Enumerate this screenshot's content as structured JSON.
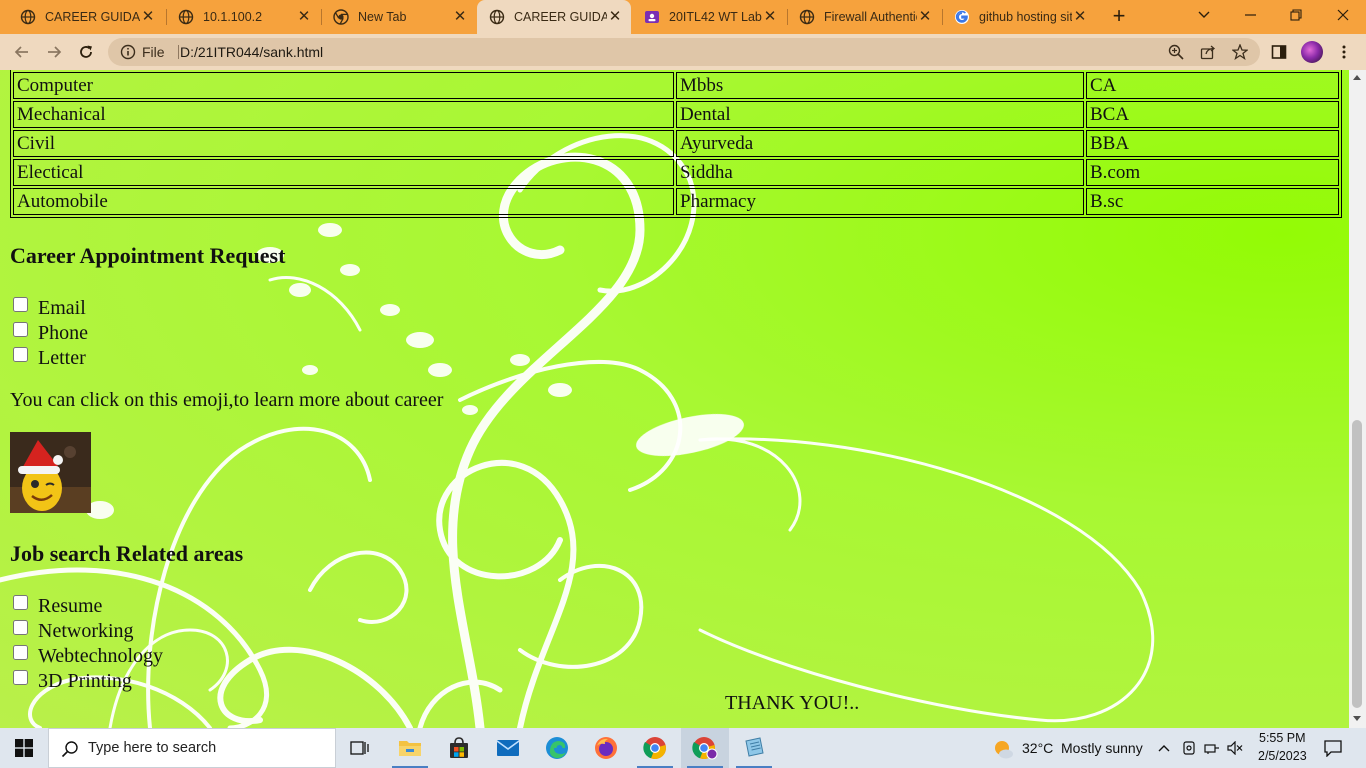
{
  "browser": {
    "tabs": [
      {
        "title": "CAREER GUIDANCE",
        "icon": "globe-icon",
        "active": false
      },
      {
        "title": "10.1.100.2",
        "icon": "globe-icon",
        "active": false
      },
      {
        "title": "New Tab",
        "icon": "chrome-icon",
        "active": false
      },
      {
        "title": "CAREER GUIDANCE",
        "icon": "globe-icon",
        "active": true
      },
      {
        "title": "20ITL42 WT Lab",
        "icon": "classroom-icon",
        "active": false
      },
      {
        "title": "Firewall Authentication",
        "icon": "globe-icon",
        "active": false
      },
      {
        "title": "github hosting site",
        "icon": "google-icon",
        "active": false
      }
    ],
    "address": {
      "file_label": "File",
      "url": "D:/21ITR044/sank.html"
    }
  },
  "page": {
    "courses_table": {
      "rows": [
        [
          "Computer",
          "Mbbs",
          "CA"
        ],
        [
          "Mechanical",
          "Dental",
          "BCA"
        ],
        [
          "Civil",
          "Ayurveda",
          "BBA"
        ],
        [
          "Electical",
          "Siddha",
          "B.com"
        ],
        [
          "Automobile",
          "Pharmacy",
          "B.sc"
        ]
      ]
    },
    "appointment": {
      "heading": "Career Appointment Request",
      "options": [
        "Email",
        "Phone",
        "Letter"
      ]
    },
    "emoji_text": "You can click on this emoji,to learn more about career",
    "job_search": {
      "heading": "Job search Related areas",
      "options": [
        "Resume",
        "Networking",
        "Webtechnology",
        "3D Printing"
      ]
    },
    "thanks": "THANK YOU!.."
  },
  "taskbar": {
    "search_placeholder": "Type here to search",
    "apps": [
      "task-view-icon",
      "file-explorer-icon",
      "store-icon",
      "mail-icon",
      "edge-icon",
      "firefox-icon",
      "chrome-icon",
      "chrome-profile-icon",
      "notepad-icon"
    ],
    "weather": {
      "temp": "32°C",
      "desc": "Mostly sunny"
    },
    "clock": {
      "time": "5:55 PM",
      "date": "2/5/2023"
    }
  },
  "colors": {
    "tabstrip": "#f6a23d",
    "toolbar": "#efd9bf",
    "page_background": "#a8f832"
  }
}
